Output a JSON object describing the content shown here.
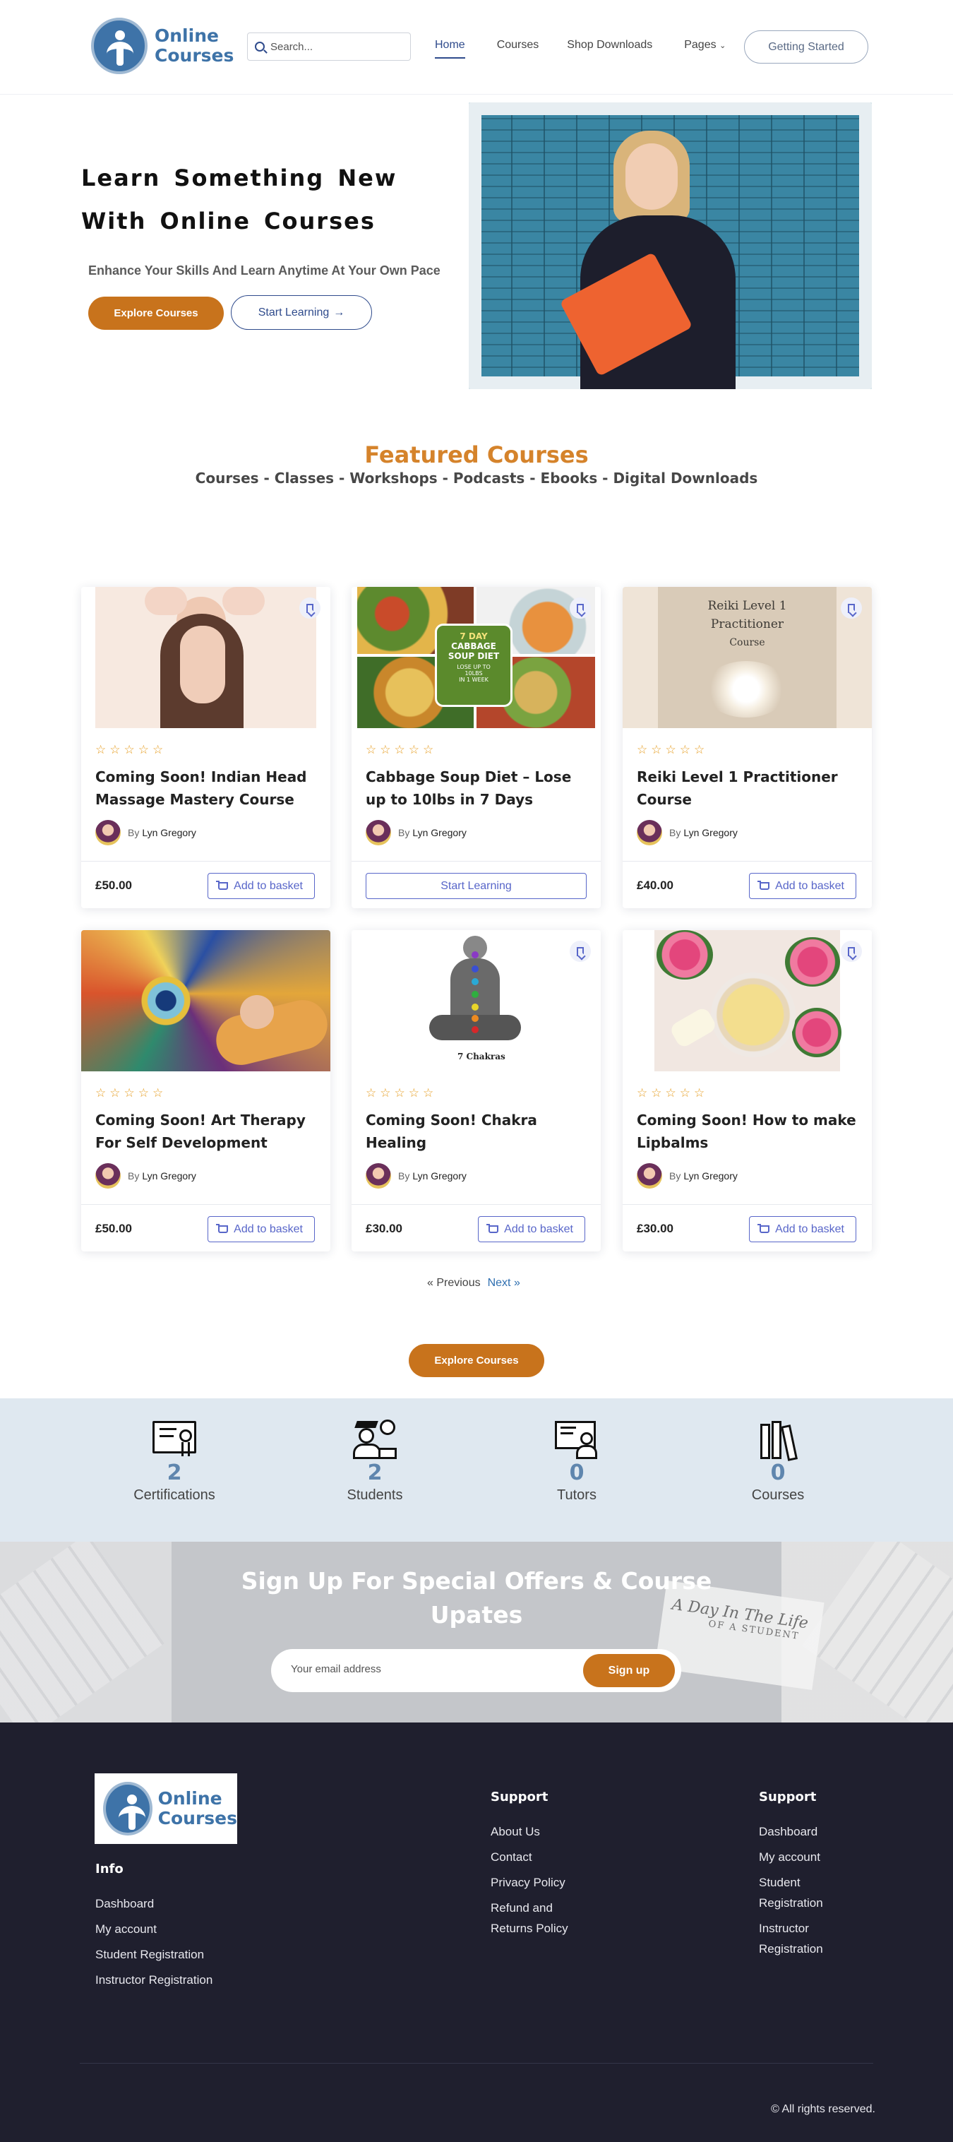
{
  "header": {
    "logo_line1": "Online",
    "logo_line2": "Courses",
    "search_placeholder": "Search...",
    "nav": [
      "Home",
      "Courses",
      "Shop Downloads",
      "Pages"
    ],
    "cta": "Getting Started"
  },
  "hero": {
    "title_line1": "Learn Something New",
    "title_line2": "With Online Courses",
    "subtitle": "Enhance Your Skills And Learn Anytime At Your Own Pace",
    "explore_label": "Explore Courses",
    "start_label": "Start Learning"
  },
  "featured": {
    "title": "Featured Courses",
    "subtitle": "Courses - Classes - Workshops - Podcasts - Ebooks - Digital Downloads"
  },
  "courses": [
    {
      "title": "Coming Soon! Indian Head Massage Mastery Course",
      "author": "Lyn Gregory",
      "by": "By",
      "price": "£50.00",
      "action": "Add to basket"
    },
    {
      "title": "Cabbage Soup Diet – Lose up to 10lbs in 7 Days",
      "author": "Lyn Gregory",
      "by": "By",
      "price": "",
      "action": "Start Learning",
      "image_text": [
        "7 DAY",
        "CABBAGE",
        "SOUP DIET",
        "LOSE UP TO",
        "10LBS",
        "IN 1 WEEK"
      ]
    },
    {
      "title": "Reiki Level 1 Practitioner Course",
      "author": "Lyn Gregory",
      "by": "By",
      "price": "£40.00",
      "action": "Add to basket",
      "image_text": [
        "Reiki Level 1",
        "Practitioner",
        "Course"
      ]
    },
    {
      "title": "Coming Soon! Art Therapy For Self Development",
      "author": "Lyn Gregory",
      "by": "By",
      "price": "£50.00",
      "action": "Add to basket"
    },
    {
      "title": "Coming Soon! Chakra Healing",
      "author": "Lyn Gregory",
      "by": "By",
      "price": "£30.00",
      "action": "Add to basket",
      "image_text": [
        "7 Chakras"
      ]
    },
    {
      "title": "Coming Soon! How to make Lipbalms",
      "author": "Lyn Gregory",
      "by": "By",
      "price": "£30.00",
      "action": "Add to basket"
    }
  ],
  "pager": {
    "prev": "« Previous",
    "next": "Next »"
  },
  "explore_bottom": "Explore Courses",
  "stats": [
    {
      "value": "2",
      "label": "Certifications",
      "icon": "certificate-icon"
    },
    {
      "value": "2",
      "label": "Students",
      "icon": "student-icon"
    },
    {
      "value": "0",
      "label": "Tutors",
      "icon": "tutor-icon"
    },
    {
      "value": "0",
      "label": "Courses",
      "icon": "books-icon"
    }
  ],
  "signup": {
    "title_line1": "Sign Up For Special Offers & Course",
    "title_line2": "Upates",
    "email_placeholder": "Your email address",
    "button": "Sign up",
    "note_line1": "A Day In The Life",
    "note_line2": "OF A STUDENT"
  },
  "footer": {
    "info_heading": "Info",
    "info_links": [
      "Dashboard",
      "My account",
      "Student Registration",
      "Instructor Registration"
    ],
    "support1_heading": "Support",
    "support1_links": [
      "About Us",
      "Contact",
      "Privacy Policy",
      "Refund and",
      "Returns Policy"
    ],
    "support2_heading": "Support",
    "support2_links": [
      "Dashboard",
      "My account",
      "Student",
      "Registration",
      "Instructor",
      "Registration"
    ],
    "copyright": "© All rights reserved."
  },
  "colors": {
    "brand_blue": "#3e73a8",
    "accent_orange": "#c8731c",
    "footer_bg": "#1f1f2e",
    "stats_bg": "#dfe8f0"
  }
}
